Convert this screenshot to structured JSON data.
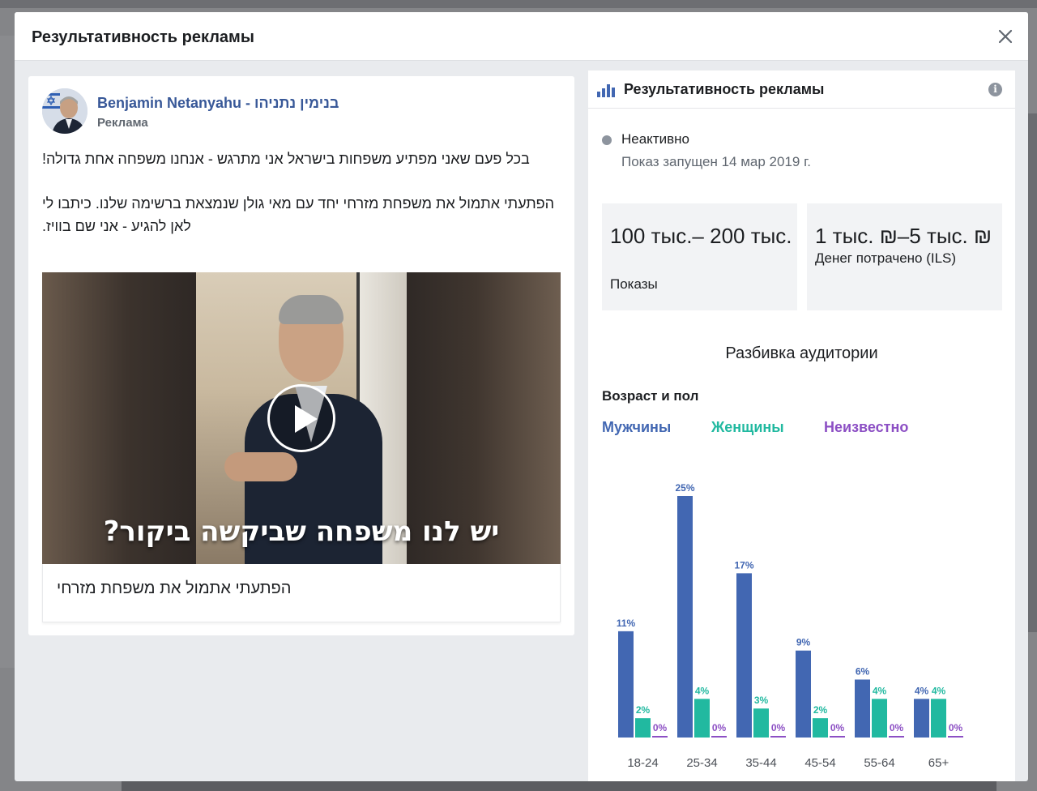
{
  "modal": {
    "title": "Результативность рекламы"
  },
  "ad": {
    "page_name": "Benjamin Netanyahu - בנימין נתניהו",
    "sponsored_label": "Реклама",
    "text_lines": [
      "בכל פעם שאני מפתיע משפחות בישראל אני מתרגש - אנחנו משפחה אחת גדולה!",
      "הפתעתי אתמול את משפחת מזרחי יחד עם מאי גולן שנמצאת ברשימה שלנו. כיתבו לי לאן להגיע - אני שם בוויז."
    ],
    "video_caption": "יש לנו משפחה שביקשה ביקור?",
    "link_caption": "הפתעתי אתמול את משפחת מזרחי"
  },
  "performance": {
    "title": "Результативность рекламы",
    "status": "Неактивно",
    "launched": "Показ запущен 14 мар 2019 г.",
    "impressions_value": "100 тыс.– 200 тыс.",
    "impressions_label": "Показы",
    "spent_value": "1 тыс. ₪–5 тыс. ₪",
    "spent_label": "Денег потрачено (ILS)",
    "audience_title": "Разбивка аудитории",
    "age_gender_title": "Возраст и пол",
    "legend_men": "Мужчины",
    "legend_women": "Женщины",
    "legend_unknown": "Неизвестно"
  },
  "colors": {
    "men": "#4267b2",
    "women": "#21b9a0",
    "unknown": "#8c4fc4"
  },
  "chart_data": {
    "type": "bar",
    "categories": [
      "18-24",
      "25-34",
      "35-44",
      "45-54",
      "55-64",
      "65+"
    ],
    "series": [
      {
        "name": "Мужчины",
        "values": [
          11,
          25,
          17,
          9,
          6,
          4
        ]
      },
      {
        "name": "Женщины",
        "values": [
          2,
          4,
          3,
          2,
          4,
          4
        ]
      },
      {
        "name": "Неизвестно",
        "values": [
          0,
          0,
          0,
          0,
          0,
          0
        ]
      }
    ],
    "value_suffix": "%",
    "ylim": [
      0,
      25
    ]
  }
}
